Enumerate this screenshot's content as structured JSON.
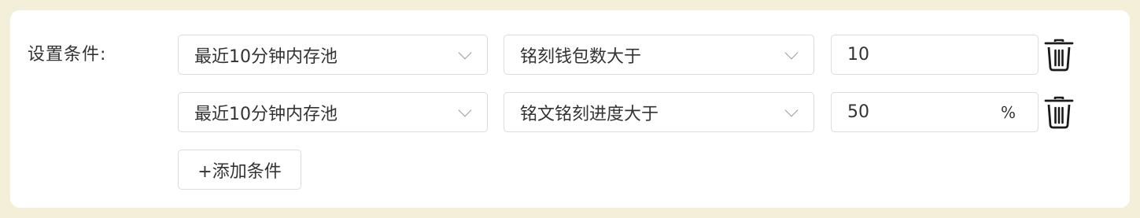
{
  "label": "设置条件:",
  "conditions": [
    {
      "scope": "最近10分钟内存池",
      "metric": "铭刻钱包数大于",
      "value": "10",
      "unit": ""
    },
    {
      "scope": "最近10分钟内存池",
      "metric": "铭文铭刻进度大于",
      "value": "50",
      "unit": "%"
    }
  ],
  "add_button": "+添加条件",
  "icons": {
    "dropdown": "chevron-down-icon",
    "delete": "trash-icon"
  }
}
